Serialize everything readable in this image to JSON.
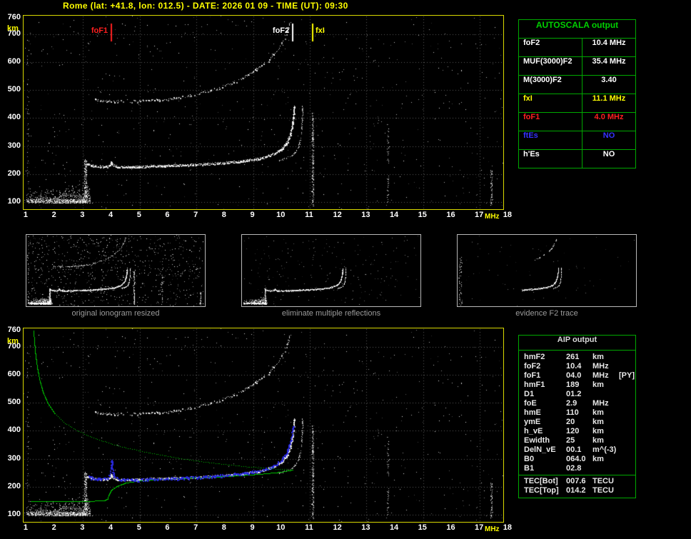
{
  "title": "Rome (lat: +41.8, lon: 012.5) - DATE: 2026 01 09 - TIME (UT): 09:30",
  "colors": {
    "background": "#000000",
    "title_yellow": "#ffff00",
    "plot_border_yellow": "#d8d800",
    "axis_text": "#ffffff",
    "unit_yellow": "#ffff00",
    "grid_gray": "#5d5d5d",
    "table_green": "#00a800",
    "autoscala_header_green": "#00d000",
    "caption_gray": "#9c9c9c",
    "trace_white": "#ffffff",
    "trace_blue": "#2a2ae0",
    "profile_green": "#00c400",
    "marker_red": "#ff2020",
    "marker_yellow": "#ffff00",
    "value_blue": "#3333ff"
  },
  "autoscala": {
    "header": "AUTOSCALA output",
    "rows": [
      {
        "label": "foF2",
        "value": "10.4 MHz",
        "color": "#ffffff"
      },
      {
        "label": "MUF(3000)F2",
        "value": "35.4 MHz",
        "color": "#ffffff"
      },
      {
        "label": "M(3000)F2",
        "value": "3.40",
        "color": "#ffffff"
      },
      {
        "label": "fxI",
        "value": "11.1 MHz",
        "color": "#ffff00"
      },
      {
        "label": "foF1",
        "value": "4.0 MHz",
        "color": "#ff2020"
      },
      {
        "label": "ftEs",
        "value": "NO",
        "color": "#3333ff"
      },
      {
        "label": "h'Es",
        "value": "NO",
        "color": "#ffffff"
      }
    ]
  },
  "thumbnails": [
    {
      "caption": "original ionogram resized"
    },
    {
      "caption": "eliminate multiple reflections"
    },
    {
      "caption": "evidence F2 trace"
    }
  ],
  "aip": {
    "header": "AIP output",
    "rows": [
      {
        "label": "hmF2",
        "value": "261",
        "unit": "km",
        "note": ""
      },
      {
        "label": "foF2",
        "value": "10.4",
        "unit": "MHz",
        "note": ""
      },
      {
        "label": "foF1",
        "value": "04.0",
        "unit": "MHz",
        "note": "[PY]"
      },
      {
        "label": "hmF1",
        "value": "189",
        "unit": "km",
        "note": ""
      },
      {
        "label": "D1",
        "value": "01.2",
        "unit": "",
        "note": ""
      },
      {
        "label": "foE",
        "value": "2.9",
        "unit": "MHz",
        "note": ""
      },
      {
        "label": "hmE",
        "value": "110",
        "unit": "km",
        "note": ""
      },
      {
        "label": "ymE",
        "value": "20",
        "unit": "km",
        "note": ""
      },
      {
        "label": "h_vE",
        "value": "120",
        "unit": "km",
        "note": ""
      },
      {
        "label": "Ewidth",
        "value": "25",
        "unit": "km",
        "note": ""
      },
      {
        "label": "DelN_vE",
        "value": "00.1",
        "unit": "m^(-3)",
        "note": ""
      },
      {
        "label": "B0",
        "value": "064.0",
        "unit": "km",
        "note": ""
      },
      {
        "label": "B1",
        "value": "02.8",
        "unit": "",
        "note": ""
      },
      {
        "label": "TEC[Bot]",
        "value": "007.6",
        "unit": "TECU",
        "note": "",
        "sep": true
      },
      {
        "label": "TEC[Top]",
        "value": "014.2",
        "unit": "TECU",
        "note": ""
      }
    ]
  },
  "chart_data": {
    "type": "scatter",
    "description": "Vertical-incidence ionogram (virtual height km vs frequency MHz) with Autoscala autoscaled critical frequencies, restored trace (blue) and AIP electron density profile (green)",
    "x_label": "MHz",
    "y_label": "km",
    "x_ticks": [
      1,
      2,
      3,
      4,
      5,
      6,
      7,
      8,
      9,
      10,
      11,
      12,
      13,
      14,
      15,
      16,
      17,
      18
    ],
    "y_ticks": [
      760,
      700,
      600,
      500,
      400,
      300,
      200,
      100
    ],
    "x_range": [
      0.9,
      17.83
    ],
    "y_range": [
      74,
      767
    ],
    "grid_x": [
      3,
      5,
      7,
      9,
      11,
      13,
      15,
      17
    ],
    "grid_y": [
      100,
      200,
      300,
      400,
      500,
      600,
      700
    ],
    "markers": [
      {
        "label": "foF1",
        "freq_mhz": 4.0,
        "color": "#ff2020",
        "label_side": "left"
      },
      {
        "label": "foF2",
        "freq_mhz": 10.4,
        "color": "#ffffff",
        "label_side": "left"
      },
      {
        "label": "fxI",
        "freq_mhz": 11.1,
        "color": "#ffff00",
        "label_side": "right"
      }
    ],
    "f_trace": [
      [
        3.15,
        238
      ],
      [
        3.3,
        231
      ],
      [
        3.5,
        228
      ],
      [
        3.8,
        226
      ],
      [
        3.95,
        232
      ],
      [
        4.0,
        244
      ],
      [
        4.05,
        233
      ],
      [
        4.2,
        227
      ],
      [
        4.5,
        225
      ],
      [
        5.0,
        226
      ],
      [
        5.5,
        228
      ],
      [
        6.0,
        230
      ],
      [
        6.5,
        232
      ],
      [
        7.0,
        234
      ],
      [
        7.5,
        237
      ],
      [
        8.0,
        240
      ],
      [
        8.5,
        245
      ],
      [
        9.0,
        252
      ],
      [
        9.3,
        258
      ],
      [
        9.6,
        267
      ],
      [
        9.85,
        278
      ],
      [
        10.05,
        294
      ],
      [
        10.2,
        315
      ],
      [
        10.3,
        340
      ],
      [
        10.37,
        370
      ],
      [
        10.42,
        405
      ],
      [
        10.45,
        445
      ]
    ],
    "x_mode_trace": [
      [
        9.9,
        249
      ],
      [
        10.15,
        256
      ],
      [
        10.35,
        266
      ],
      [
        10.5,
        280
      ],
      [
        10.6,
        300
      ],
      [
        10.67,
        330
      ],
      [
        10.71,
        370
      ],
      [
        10.73,
        415
      ],
      [
        10.74,
        452
      ]
    ],
    "second_hop": [
      [
        3.4,
        466
      ],
      [
        3.8,
        462
      ],
      [
        4.3,
        461
      ],
      [
        4.9,
        462
      ],
      [
        5.5,
        465
      ],
      [
        6.0,
        469
      ],
      [
        6.5,
        476
      ],
      [
        7.0,
        486
      ],
      [
        7.5,
        500
      ],
      [
        8.0,
        517
      ],
      [
        8.5,
        538
      ],
      [
        8.9,
        560
      ],
      [
        9.3,
        588
      ],
      [
        9.6,
        615
      ],
      [
        9.85,
        645
      ],
      [
        10.05,
        678
      ],
      [
        10.2,
        712
      ],
      [
        10.3,
        745
      ]
    ],
    "profile_topside": [
      [
        1.25,
        760
      ],
      [
        1.28,
        716
      ],
      [
        1.32,
        672
      ],
      [
        1.38,
        628
      ],
      [
        1.46,
        584
      ],
      [
        1.58,
        540
      ],
      [
        1.75,
        500
      ],
      [
        2.0,
        462
      ],
      [
        2.35,
        428
      ],
      [
        2.85,
        398
      ],
      [
        3.5,
        370
      ],
      [
        4.3,
        345
      ],
      [
        5.3,
        322
      ],
      [
        6.4,
        302
      ],
      [
        7.6,
        285
      ],
      [
        8.8,
        272
      ],
      [
        9.8,
        264
      ],
      [
        10.4,
        261
      ]
    ],
    "profile_bottomside": [
      [
        10.4,
        261
      ],
      [
        10.0,
        253
      ],
      [
        9.3,
        246
      ],
      [
        8.5,
        240
      ],
      [
        7.6,
        235
      ],
      [
        6.7,
        231
      ],
      [
        5.8,
        227
      ],
      [
        5.0,
        222
      ],
      [
        4.5,
        214
      ],
      [
        4.2,
        202
      ],
      [
        4.0,
        189
      ],
      [
        3.95,
        180
      ],
      [
        3.9,
        168
      ],
      [
        3.86,
        157
      ],
      [
        3.78,
        152
      ],
      [
        3.6,
        150
      ],
      [
        3.3,
        149
      ],
      [
        3.0,
        148
      ],
      [
        2.6,
        148
      ],
      [
        2.2,
        147
      ],
      [
        1.8,
        147
      ],
      [
        1.4,
        147
      ],
      [
        1.15,
        147
      ]
    ],
    "restored_trace_blue": [
      [
        3.2,
        234
      ],
      [
        3.5,
        229
      ],
      [
        3.75,
        227
      ],
      [
        3.9,
        235
      ],
      [
        3.97,
        262
      ],
      [
        4.0,
        293
      ],
      [
        4.03,
        263
      ],
      [
        4.1,
        236
      ],
      [
        4.3,
        227
      ],
      [
        4.7,
        225
      ],
      [
        5.2,
        226
      ],
      [
        5.8,
        229
      ],
      [
        6.4,
        231
      ],
      [
        7.0,
        234
      ],
      [
        7.6,
        238
      ],
      [
        8.2,
        243
      ],
      [
        8.8,
        250
      ],
      [
        9.2,
        258
      ],
      [
        9.55,
        268
      ],
      [
        9.8,
        280
      ],
      [
        10.0,
        298
      ],
      [
        10.17,
        322
      ],
      [
        10.28,
        352
      ],
      [
        10.36,
        388
      ],
      [
        10.42,
        425
      ]
    ],
    "noise_columns": [
      {
        "f": 11.1,
        "h_min": 85,
        "h_max": 420,
        "n": 230
      },
      {
        "f": 13.75,
        "h_min": 95,
        "h_max": 380,
        "n": 55
      },
      {
        "f": 17.4,
        "h_min": 85,
        "h_max": 215,
        "n": 70
      },
      {
        "f": 1.05,
        "h_min": 95,
        "h_max": 700,
        "n": 55
      }
    ],
    "e_region": {
      "f_min": 1.0,
      "f_max": 3.25,
      "h_min": 96,
      "h_max": 175,
      "spike_f": 3.03,
      "spike_h_min": 112,
      "spike_h_max": 252
    }
  }
}
